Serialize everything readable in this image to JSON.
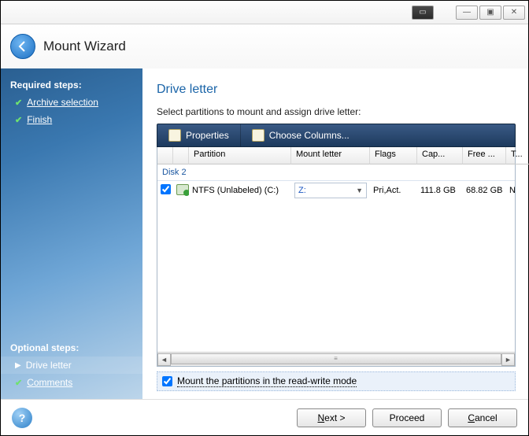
{
  "header": {
    "title": "Mount Wizard"
  },
  "sidebar": {
    "required_heading": "Required steps:",
    "required": [
      {
        "label": "Archive selection",
        "done": true
      },
      {
        "label": "Finish",
        "done": true
      }
    ],
    "optional_heading": "Optional steps:",
    "optional": [
      {
        "label": "Drive letter",
        "active": true
      },
      {
        "label": "Comments",
        "done": true
      }
    ]
  },
  "main": {
    "heading": "Drive letter",
    "instruction": "Select partitions to mount and assign drive letter:",
    "toolbar": {
      "properties": "Properties",
      "choose_columns": "Choose Columns..."
    },
    "columns": {
      "partition": "Partition",
      "mount_letter": "Mount letter",
      "flags": "Flags",
      "capacity": "Cap...",
      "free": "Free ...",
      "type": "T..."
    },
    "group": "Disk 2",
    "row": {
      "checked": true,
      "partition": "NTFS (Unlabeled) (C:)",
      "mount_letter": "Z:",
      "flags": "Pri,Act.",
      "capacity": "111.8 GB",
      "free": "68.82 GB",
      "type": "NTFS"
    },
    "readwrite": {
      "checked": true,
      "label": "Mount the partitions in the read-write mode"
    }
  },
  "footer": {
    "next": "Next >",
    "proceed": "Proceed",
    "cancel": "Cancel"
  }
}
